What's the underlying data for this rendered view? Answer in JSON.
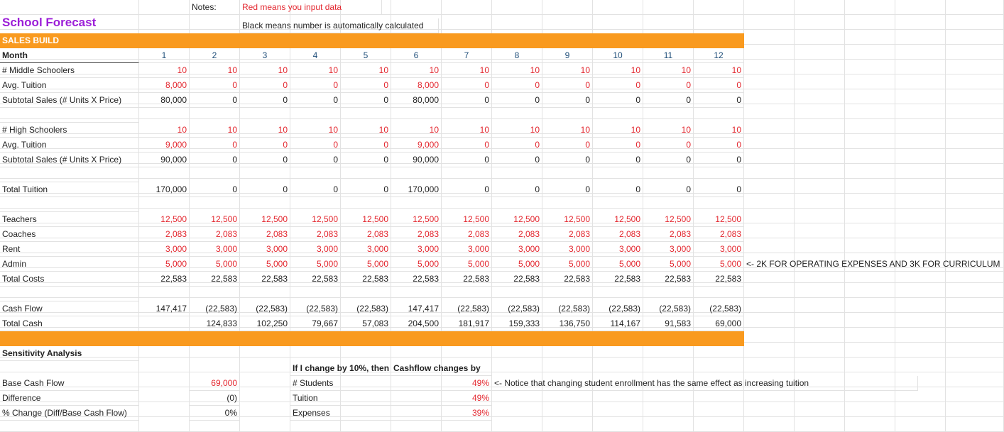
{
  "top": {
    "notes_label": "Notes:",
    "notes_red": "Red means you input data",
    "notes_black": "Black means number is automatically calculated",
    "title": "School Forecast",
    "sales_build": "SALES BUILD"
  },
  "months": [
    "1",
    "2",
    "3",
    "4",
    "5",
    "6",
    "7",
    "8",
    "9",
    "10",
    "11",
    "12"
  ],
  "rows": [
    {
      "label": "Month",
      "values": [],
      "style": "header"
    },
    {
      "label": "# Middle Schoolers",
      "values": [
        "10",
        "10",
        "10",
        "10",
        "10",
        "10",
        "10",
        "10",
        "10",
        "10",
        "10",
        "10"
      ],
      "style": "red"
    },
    {
      "label": "Avg. Tuition",
      "values": [
        "8,000",
        "0",
        "0",
        "0",
        "0",
        "8,000",
        "0",
        "0",
        "0",
        "0",
        "0",
        "0"
      ],
      "style": "red"
    },
    {
      "label": "Subtotal Sales (# Units X Price)",
      "values": [
        "80,000",
        "0",
        "0",
        "0",
        "0",
        "80,000",
        "0",
        "0",
        "0",
        "0",
        "0",
        "0"
      ],
      "style": "black"
    },
    {
      "label": "",
      "values": [],
      "style": "blank"
    },
    {
      "label": "# High Schoolers",
      "values": [
        "10",
        "10",
        "10",
        "10",
        "10",
        "10",
        "10",
        "10",
        "10",
        "10",
        "10",
        "10"
      ],
      "style": "red"
    },
    {
      "label": "Avg. Tuition",
      "values": [
        "9,000",
        "0",
        "0",
        "0",
        "0",
        "9,000",
        "0",
        "0",
        "0",
        "0",
        "0",
        "0"
      ],
      "style": "red"
    },
    {
      "label": "Subtotal Sales (# Units X Price)",
      "values": [
        "90,000",
        "0",
        "0",
        "0",
        "0",
        "90,000",
        "0",
        "0",
        "0",
        "0",
        "0",
        "0"
      ],
      "style": "black"
    },
    {
      "label": "",
      "values": [],
      "style": "blank"
    },
    {
      "label": "Total Tuition",
      "values": [
        "170,000",
        "0",
        "0",
        "0",
        "0",
        "170,000",
        "0",
        "0",
        "0",
        "0",
        "0",
        "0"
      ],
      "style": "black"
    },
    {
      "label": "",
      "values": [],
      "style": "blank"
    },
    {
      "label": "Teachers",
      "values": [
        "12,500",
        "12,500",
        "12,500",
        "12,500",
        "12,500",
        "12,500",
        "12,500",
        "12,500",
        "12,500",
        "12,500",
        "12,500",
        "12,500"
      ],
      "style": "red"
    },
    {
      "label": "Coaches",
      "values": [
        "2,083",
        "2,083",
        "2,083",
        "2,083",
        "2,083",
        "2,083",
        "2,083",
        "2,083",
        "2,083",
        "2,083",
        "2,083",
        "2,083"
      ],
      "style": "red"
    },
    {
      "label": "Rent",
      "values": [
        "3,000",
        "3,000",
        "3,000",
        "3,000",
        "3,000",
        "3,000",
        "3,000",
        "3,000",
        "3,000",
        "3,000",
        "3,000",
        "3,000"
      ],
      "style": "red"
    },
    {
      "label": "Admin",
      "values": [
        "5,000",
        "5,000",
        "5,000",
        "5,000",
        "5,000",
        "5,000",
        "5,000",
        "5,000",
        "5,000",
        "5,000",
        "5,000",
        "5,000"
      ],
      "style": "red"
    },
    {
      "label": "Total Costs",
      "values": [
        "22,583",
        "22,583",
        "22,583",
        "22,583",
        "22,583",
        "22,583",
        "22,583",
        "22,583",
        "22,583",
        "22,583",
        "22,583",
        "22,583"
      ],
      "style": "black"
    },
    {
      "label": "",
      "values": [],
      "style": "blank"
    },
    {
      "label": "Cash Flow",
      "values": [
        "147,417",
        "(22,583)",
        "(22,583)",
        "(22,583)",
        "(22,583)",
        "147,417",
        "(22,583)",
        "(22,583)",
        "(22,583)",
        "(22,583)",
        "(22,583)",
        "(22,583)"
      ],
      "style": "black"
    },
    {
      "label": "Total Cash",
      "values": [
        "",
        "124,833",
        "102,250",
        "79,667",
        "57,083",
        "204,500",
        "181,917",
        "159,333",
        "136,750",
        "114,167",
        "91,583",
        "69,000"
      ],
      "style": "black"
    }
  ],
  "admin_note": "<- 2K FOR OPERATING EXPENSES AND 3K FOR CURRICULUM",
  "sensitivity": {
    "title": "Sensitivity Analysis",
    "header_left": "If I change by 10%, then",
    "header_right": "Cashflow changes by",
    "rows": [
      {
        "label": "Base Cash Flow",
        "value": "69,000",
        "item": "# Students",
        "pct": "49%"
      },
      {
        "label": "Difference",
        "value": "(0)",
        "item": "Tuition",
        "pct": "49%"
      },
      {
        "label": "% Change (Diff/Base Cash Flow)",
        "value": "0%",
        "item": "Expenses",
        "pct": "39%"
      }
    ],
    "note": "<- Notice that changing student enrollment has the same effect as increasing tuition"
  },
  "colors": {
    "accent_orange": "#f99a1f",
    "input_red": "#e3262e",
    "title_purple": "#9c1ed8"
  }
}
